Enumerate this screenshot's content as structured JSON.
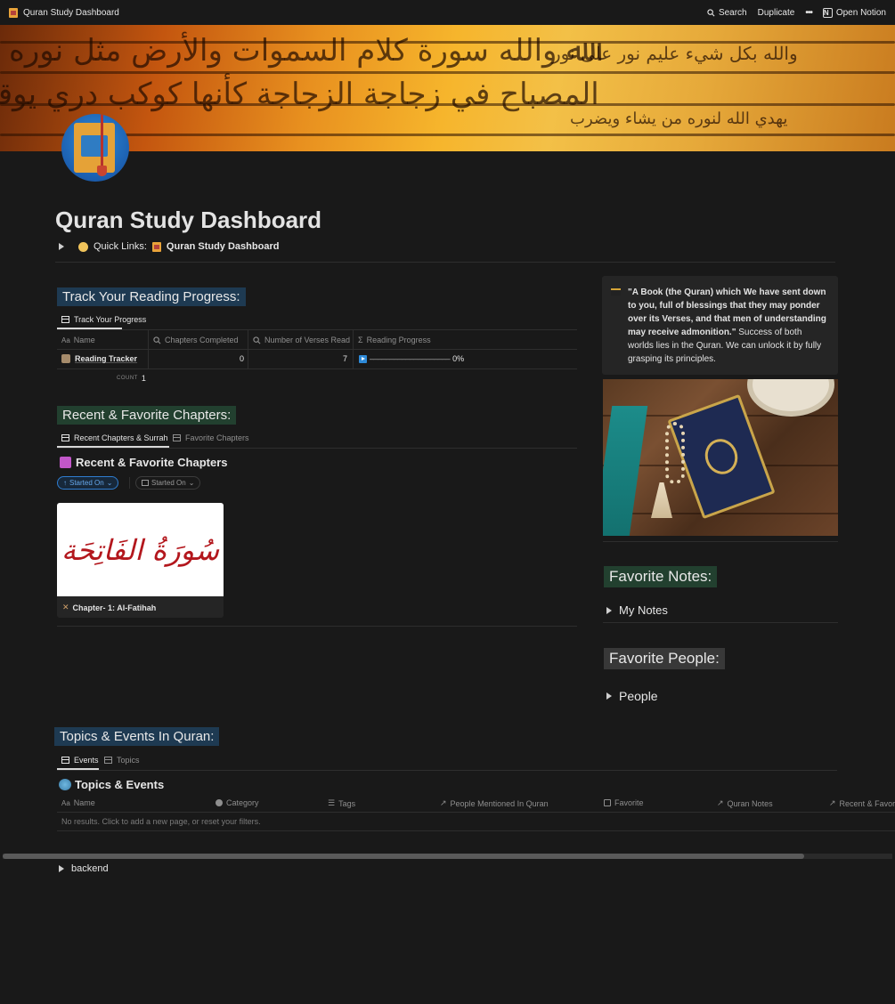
{
  "topbar": {
    "page_name": "Quran Study Dashboard",
    "search_label": "Search",
    "duplicate_label": "Duplicate",
    "more_label": "•••",
    "open_notion_label": "Open Notion"
  },
  "page": {
    "title": "Quran Study Dashboard",
    "quick_links_label": "Quick Links:",
    "quick_links_target": "Quran Study Dashboard"
  },
  "reading": {
    "heading": "Track Your Reading Progress:",
    "tab_label": "Track Your Progress",
    "columns": [
      "Name",
      "Chapters Completed",
      "Number of Verses Read",
      "Reading Progress"
    ],
    "rows": [
      {
        "name": "Reading Tracker",
        "chapters": "0",
        "verses": "7",
        "progress_label": "0%",
        "progress": 0
      }
    ],
    "count_label": "COUNT",
    "count_value": "1"
  },
  "chapters": {
    "heading": "Recent & Favorite Chapters:",
    "tabs": [
      "Recent Chapters & Surrah",
      "Favorite Chapters"
    ],
    "db_title": "Recent & Favorite Chapters",
    "sort_pill": "Started On",
    "filter_pill": "Started On",
    "card_arabic": "سُورَةُ الفَاتِحَة",
    "card_caption": "Chapter- 1: Al-Fatihah"
  },
  "quote": {
    "bold_text": "\"A Book (the Quran) which We have sent down to you, full of blessings that they may ponder over its Verses, and that men of understanding may receive admonition.\"",
    "plain_text": " Success of both worlds lies in the Quran. We can unlock it by fully grasping its principles."
  },
  "notes": {
    "heading": "Favorite Notes:",
    "toggle_label": "My Notes"
  },
  "people": {
    "heading": "Favorite People:",
    "toggle_label": "People"
  },
  "topics": {
    "heading": "Topics & Events In Quran:",
    "tabs": [
      "Events",
      "Topics"
    ],
    "db_title": "Topics & Events",
    "columns": [
      "Name",
      "Category",
      "Tags",
      "People Mentioned In Quran",
      "Favorite",
      "Quran Notes",
      "Recent & Favor"
    ],
    "empty_text": "No results. Click to add a new page, or reset your filters."
  },
  "backend": {
    "toggle_label": "backend"
  },
  "colors": {
    "background": "#191919",
    "heading_blue": "#1e3a52",
    "heading_green": "#22402f",
    "heading_gray": "#383838",
    "accent_blue": "#2e8ad8"
  }
}
